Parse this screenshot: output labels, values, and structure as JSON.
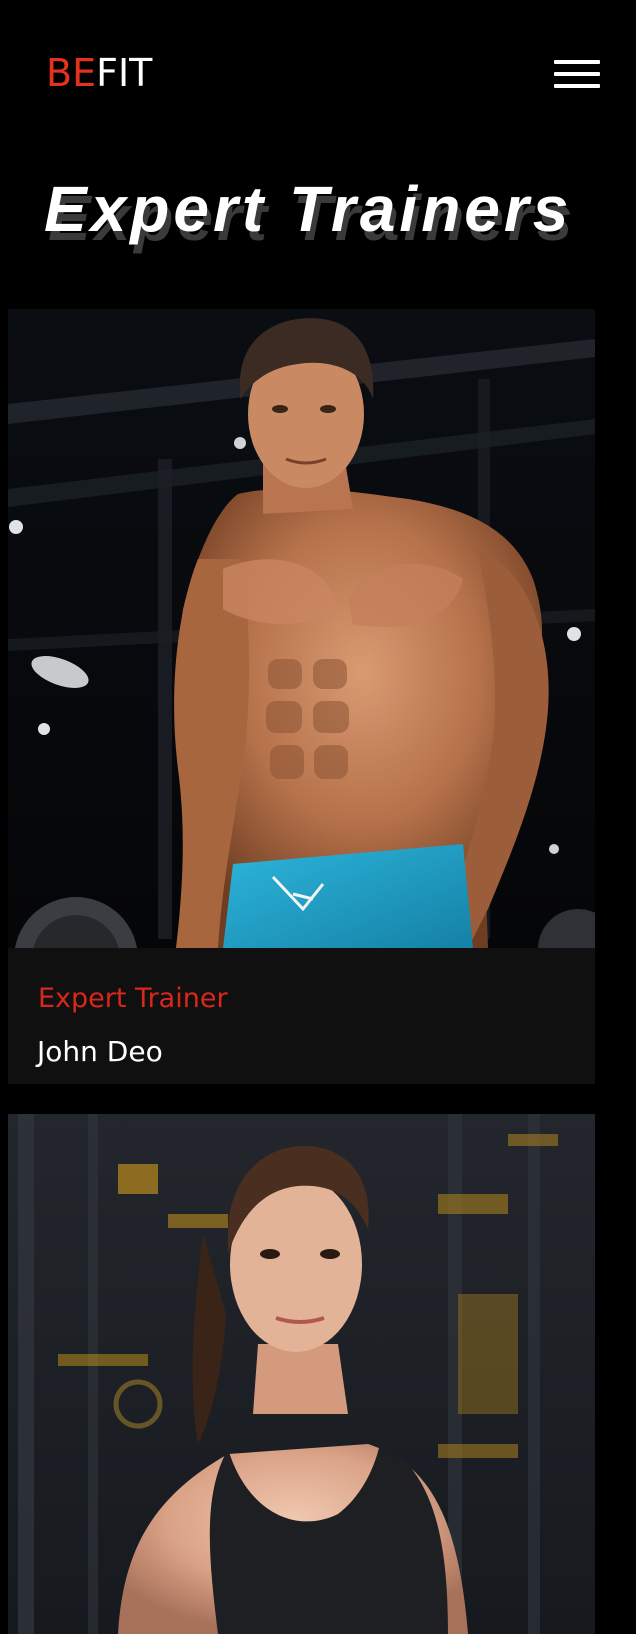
{
  "header": {
    "logo_accent": "BE",
    "logo_rest": "FIT",
    "accent_color": "#e3321e",
    "menu_icon": "hamburger-menu-icon"
  },
  "section": {
    "title": "Expert Trainers"
  },
  "trainers": [
    {
      "role": "Expert Trainer",
      "name": "John Deo",
      "photo": "male-trainer-photo"
    },
    {
      "role": "",
      "name": "",
      "photo": "female-trainer-photo"
    }
  ],
  "colors": {
    "background": "#000000",
    "card_background": "#101010",
    "role_text": "#d9271b",
    "name_text": "#ffffff"
  }
}
